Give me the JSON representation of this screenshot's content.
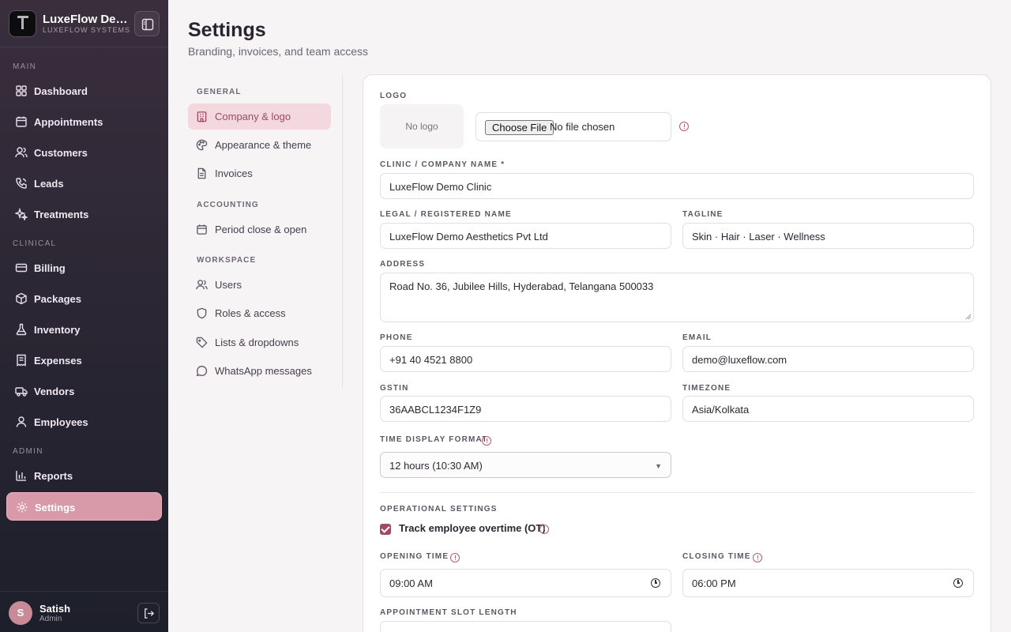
{
  "brand": {
    "name": "LuxeFlow De…",
    "subtitle": "LUXEFLOW SYSTEMS"
  },
  "sidebar": {
    "sections": {
      "main": "MAIN",
      "clinical": "CLINICAL",
      "admin": "ADMIN"
    },
    "items": [
      {
        "label": "Dashboard",
        "icon": "grid-icon"
      },
      {
        "label": "Appointments",
        "icon": "calendar-icon"
      },
      {
        "label": "Customers",
        "icon": "users-icon"
      },
      {
        "label": "Leads",
        "icon": "phone-icon"
      },
      {
        "label": "Treatments",
        "icon": "sparkle-icon"
      },
      {
        "label": "Billing",
        "icon": "card-icon"
      },
      {
        "label": "Packages",
        "icon": "package-icon"
      },
      {
        "label": "Inventory",
        "icon": "flask-icon"
      },
      {
        "label": "Expenses",
        "icon": "receipt-icon"
      },
      {
        "label": "Vendors",
        "icon": "truck-icon"
      },
      {
        "label": "Employees",
        "icon": "team-icon"
      },
      {
        "label": "Reports",
        "icon": "bar-chart-icon"
      },
      {
        "label": "Settings",
        "icon": "gear-icon",
        "active": true
      }
    ]
  },
  "user": {
    "initial": "S",
    "name": "Satish",
    "role": "Admin"
  },
  "page": {
    "title": "Settings",
    "subtitle": "Branding, invoices, and team access"
  },
  "subnav": {
    "sections": {
      "general": "GENERAL",
      "accounting": "ACCOUNTING",
      "workspace": "WORKSPACE"
    },
    "items": [
      {
        "label": "Company & logo",
        "active": true
      },
      {
        "label": "Appearance & theme"
      },
      {
        "label": "Invoices"
      },
      {
        "label": "Period close & open"
      },
      {
        "label": "Users"
      },
      {
        "label": "Roles & access"
      },
      {
        "label": "Lists & dropdowns"
      },
      {
        "label": "WhatsApp messages"
      }
    ]
  },
  "form": {
    "logo_label": "LOGO",
    "no_logo": "No logo",
    "file_button": "Choose File",
    "file_text": "No file chosen",
    "company_name_label": "CLINIC / COMPANY NAME *",
    "company_name": "LuxeFlow Demo Clinic",
    "legal_name_label": "LEGAL / REGISTERED NAME",
    "legal_name": "LuxeFlow Demo Aesthetics Pvt Ltd",
    "tagline_label": "TAGLINE",
    "tagline": "Skin · Hair · Laser · Wellness",
    "address_label": "ADDRESS",
    "address": "Road No. 36, Jubilee Hills, Hyderabad, Telangana 500033",
    "phone_label": "PHONE",
    "phone": "+91 40 4521 8800",
    "email_label": "EMAIL",
    "email": "demo@luxeflow.com",
    "gstin_label": "GSTIN",
    "gstin": "36AABCL1234F1Z9",
    "timezone_label": "TIMEZONE",
    "timezone": "Asia/Kolkata",
    "time_format_label": "TIME DISPLAY FORMAT",
    "time_format": "12 hours (10:30 AM)",
    "operational_label": "OPERATIONAL SETTINGS",
    "track_ot_label": "Track employee overtime (OT)",
    "track_ot_checked": true,
    "opening_time_label": "OPENING TIME",
    "opening_time": "09:00 AM",
    "closing_time_label": "CLOSING TIME",
    "closing_time": "06:00 PM",
    "slot_length_label": "APPOINTMENT SLOT LENGTH"
  }
}
